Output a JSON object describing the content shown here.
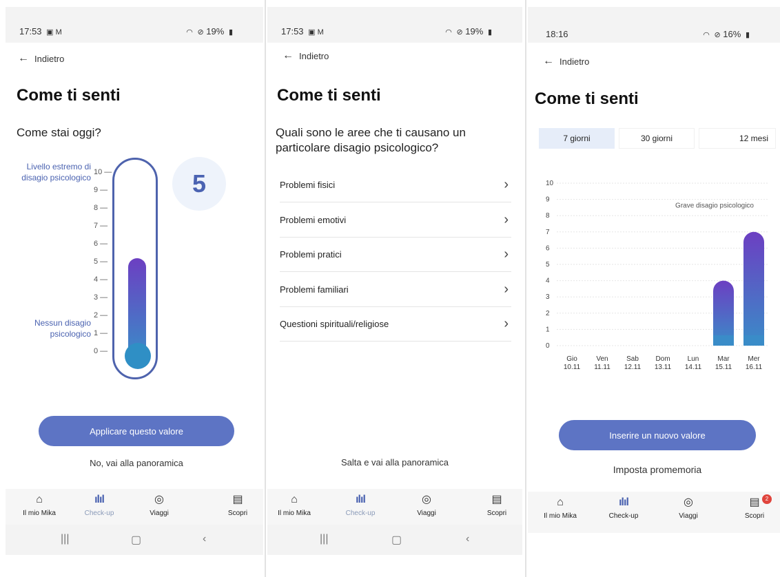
{
  "screens": [
    {
      "status_time": "17:53",
      "status_notif": "▣ M",
      "status_right": "19%",
      "back_label": "Indietro",
      "title": "Come ti senti",
      "question": "Come stai oggi?",
      "scale_top_label": "Livello estremo di disagio psicologico",
      "scale_bottom_label": "Nessun disagio psicologico",
      "scale_ticks": [
        "10 —",
        "9 —",
        "8 —",
        "7 —",
        "6 —",
        "5 —",
        "4 —",
        "3 —",
        "2 —",
        "1 —",
        "0 —"
      ],
      "selected_value": "5",
      "thermometer_level": 5,
      "apply_button": "Applicare questo valore",
      "skip_link": "No, vai alla panoramica"
    },
    {
      "status_time": "17:53",
      "status_notif": "▣ M",
      "status_right": "19%",
      "back_label": "Indietro",
      "title": "Come ti senti",
      "question": "Quali sono le aree che ti causano un particolare disagio psicologico?",
      "areas": [
        "Problemi fisici",
        "Problemi emotivi",
        "Problemi pratici",
        "Problemi familiari",
        "Questioni spirituali/religiose"
      ],
      "skip_link": "Salta e vai alla panoramica"
    },
    {
      "status_time": "18:16",
      "status_right": "16%",
      "back_label": "Indietro",
      "title": "Come ti senti",
      "tabs": [
        "7 giorni",
        "30 giorni",
        "12 mesi"
      ],
      "active_tab": "7 giorni",
      "add_button": "Inserire un nuovo valore",
      "reminder_link": "Imposta promemoria",
      "scopri_badge": "2"
    }
  ],
  "nav": {
    "home": "Il mio Mika",
    "checkup": "Check-up",
    "travel": "Viaggi",
    "discover": "Scopri"
  },
  "icons": {
    "home": "home-icon",
    "checkup": "bar-chart-icon",
    "travel": "compass-icon",
    "discover": "document-icon"
  },
  "colors": {
    "primary": "#5d74c4",
    "label_blue": "#4a62b0",
    "gradient_top": "#6c3fc2",
    "gradient_bottom": "#3a8cc8"
  },
  "chart_data": {
    "type": "bar",
    "annotation": "Grave disagio psicologico",
    "categories": [
      "Gio 10.11",
      "Ven 11.11",
      "Sab 12.11",
      "Dom 13.11",
      "Lun 14.11",
      "Mar 15.11",
      "Mer 16.11"
    ],
    "category_day": [
      "Gio",
      "Ven",
      "Sab",
      "Dom",
      "Lun",
      "Mar",
      "Mer"
    ],
    "category_date": [
      "10.11",
      "11.11",
      "12.11",
      "13.11",
      "14.11",
      "15.11",
      "16.11"
    ],
    "values": [
      null,
      null,
      null,
      null,
      null,
      4,
      7
    ],
    "ylim": [
      0,
      10
    ],
    "yticks": [
      "0",
      "1",
      "2",
      "3",
      "4",
      "5",
      "6",
      "7",
      "8",
      "9",
      "10"
    ],
    "grid": true,
    "legend": "none"
  }
}
